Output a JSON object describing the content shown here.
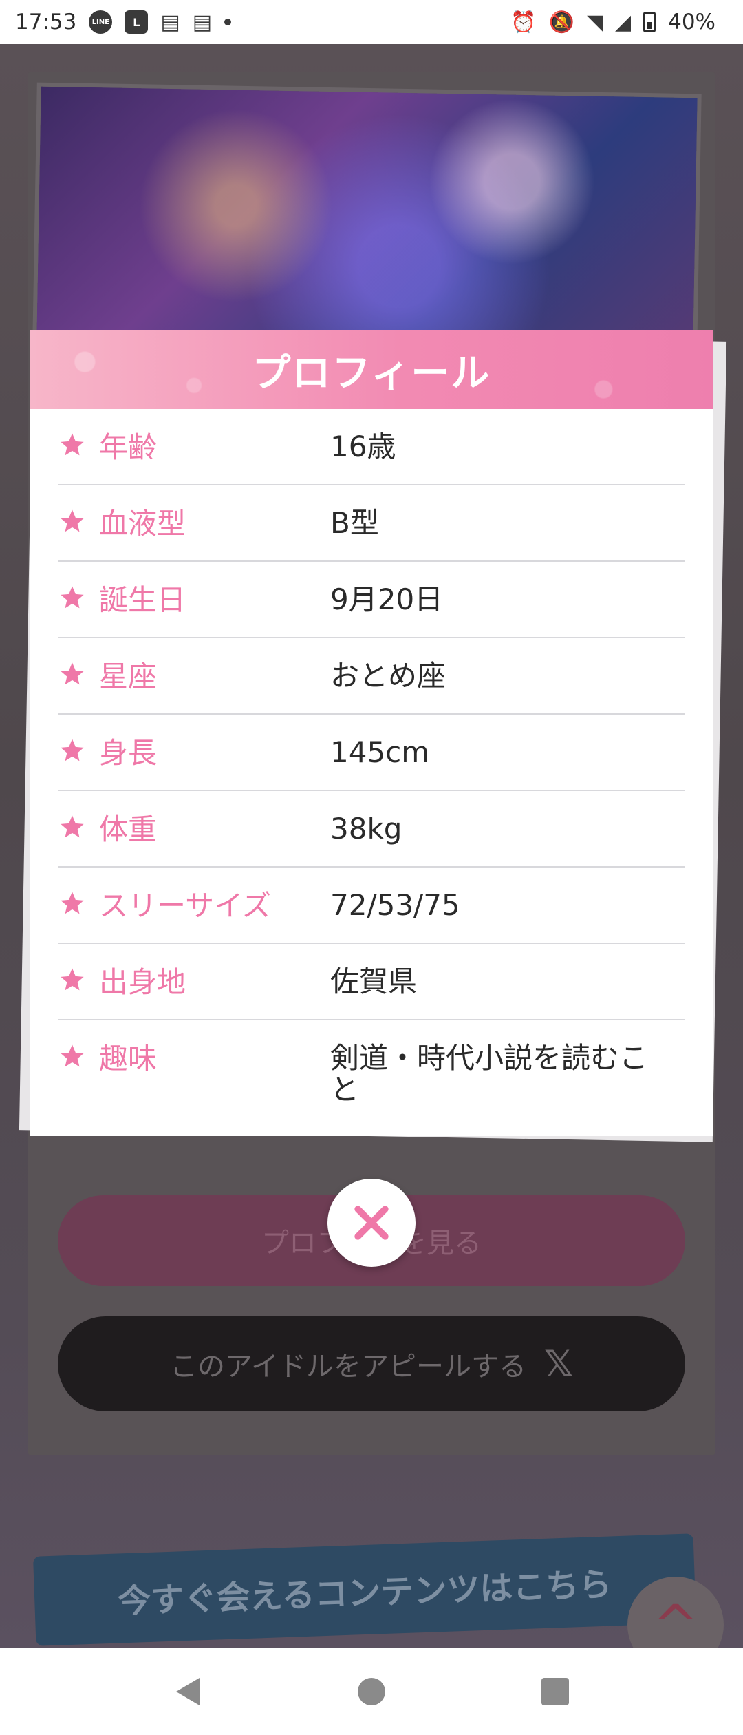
{
  "status_bar": {
    "time": "17:53",
    "battery": "40%",
    "left_icons": [
      "line-app-icon",
      "l-app-icon",
      "news-app-icon",
      "news-app-icon",
      "dot-icon"
    ],
    "right_icons": [
      "alarm-icon",
      "notifications-off-icon",
      "wifi-icon",
      "signal-icon",
      "battery-icon"
    ]
  },
  "modal": {
    "title": "プロフィール",
    "accent_color": "#ef78a8",
    "rows": [
      {
        "label": "年齢",
        "value": "16歳"
      },
      {
        "label": "血液型",
        "value": "B型"
      },
      {
        "label": "誕生日",
        "value": "9月20日"
      },
      {
        "label": "星座",
        "value": "おとめ座"
      },
      {
        "label": "身長",
        "value": "145cm"
      },
      {
        "label": "体重",
        "value": "38kg"
      },
      {
        "label": "スリーサイズ",
        "value": "72/53/75"
      },
      {
        "label": "出身地",
        "value": "佐賀県"
      },
      {
        "label": "趣味",
        "value": "剣道・時代小説を読むこと"
      }
    ]
  },
  "background_page": {
    "profile_button_label": "プロフ…ルを見る",
    "appeal_button_label": "このアイドルをアピールする",
    "appeal_icon": "x-logo-icon",
    "banner_text": "今すぐ会えるコンテンツはこちら"
  },
  "close_icon": "close-icon",
  "nav": {
    "back_icon": "back-icon",
    "home_icon": "home-icon",
    "recent_icon": "recent-apps-icon"
  }
}
